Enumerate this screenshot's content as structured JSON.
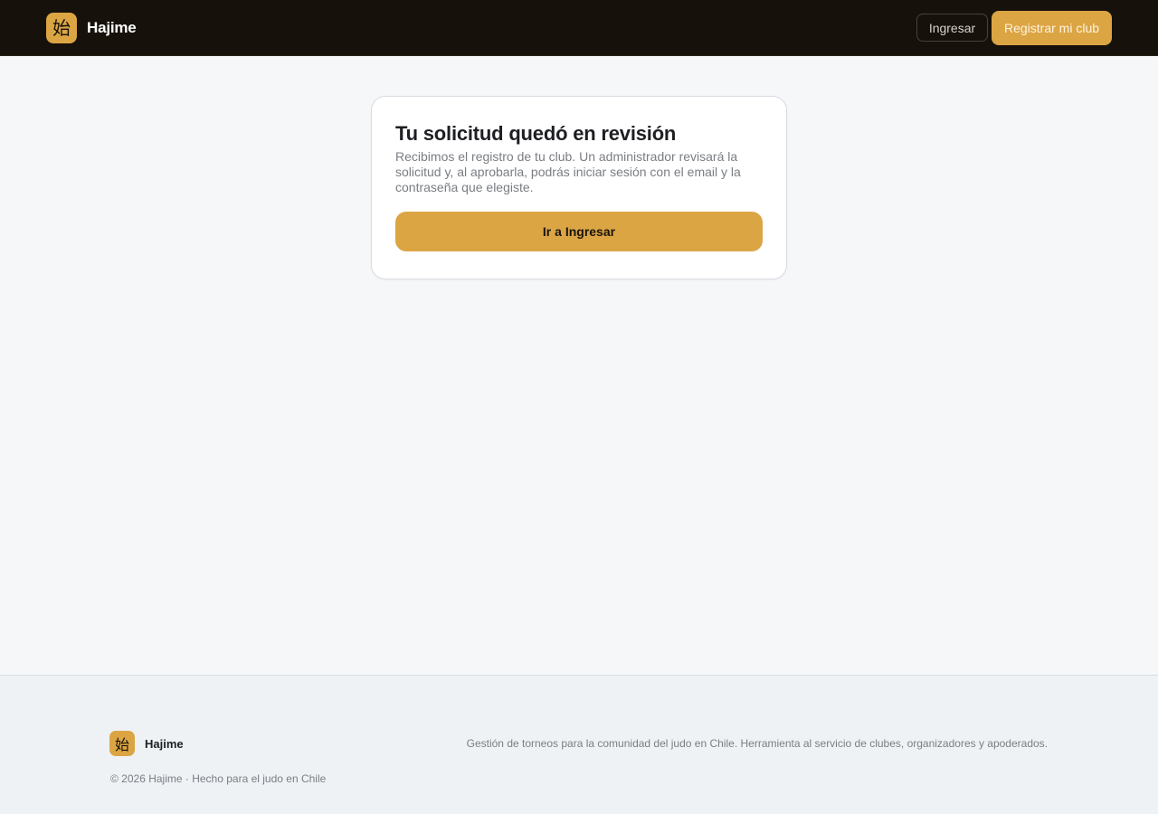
{
  "header": {
    "logo_glyph": "始",
    "brand": "Hajime",
    "login_label": "Ingresar",
    "register_label": "Registrar mi club"
  },
  "card": {
    "title": "Tu solicitud quedó en revisión",
    "text": "Recibimos el registro de tu club. Un administrador revisará la solicitud y, al aprobarla, podrás iniciar sesión con el email y la contraseña que elegiste.",
    "button_label": "Ir a Ingresar"
  },
  "footer": {
    "logo_glyph": "始",
    "brand": "Hajime",
    "description": "Gestión de torneos para la comunidad del judo en Chile. Herramienta al servicio de clubes, organizadores y apoderados.",
    "copyright": "© 2026 Hajime · Hecho para el judo en Chile"
  },
  "colors": {
    "accent": "#dca544",
    "header_bg": "#17110b",
    "page_bg": "#f6f7f9",
    "footer_bg": "#eff2f5"
  }
}
